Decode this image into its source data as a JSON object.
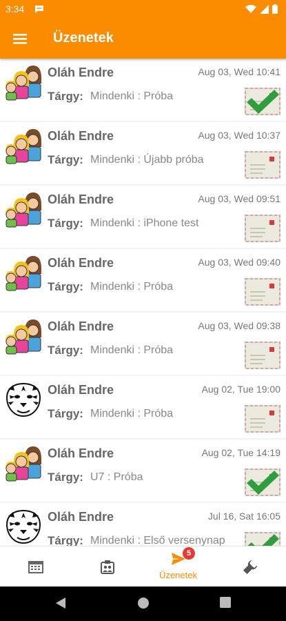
{
  "status_bar": {
    "time": "3:34"
  },
  "app_bar": {
    "title": "Üzenetek",
    "menu_icon": "hamburger-menu-icon"
  },
  "messages": [
    {
      "avatar": "family",
      "sender": "Oláh Endre",
      "date": "Aug 03, Wed 10:41",
      "subject_label": "Tárgy:",
      "subject": "Mindenki : Próba",
      "status": "read-check"
    },
    {
      "avatar": "family",
      "sender": "Oláh Endre",
      "date": "Aug 03, Wed 10:37",
      "subject_label": "Tárgy:",
      "subject": "Mindenki : Újabb próba",
      "status": "envelope"
    },
    {
      "avatar": "family",
      "sender": "Oláh Endre",
      "date": "Aug 03, Wed 09:51",
      "subject_label": "Tárgy:",
      "subject": "Mindenki : iPhone test",
      "status": "envelope"
    },
    {
      "avatar": "family",
      "sender": "Oláh Endre",
      "date": "Aug 03, Wed 09:40",
      "subject_label": "Tárgy:",
      "subject": "Mindenki : Próba",
      "status": "envelope"
    },
    {
      "avatar": "family",
      "sender": "Oláh Endre",
      "date": "Aug 03, Wed 09:38",
      "subject_label": "Tárgy:",
      "subject": "Mindenki : Próba",
      "status": "envelope"
    },
    {
      "avatar": "tiger",
      "sender": "Oláh Endre",
      "date": "Aug 02, Tue 19:00",
      "subject_label": "Tárgy:",
      "subject": "Mindenki : Próba",
      "status": "envelope"
    },
    {
      "avatar": "family",
      "sender": "Oláh Endre",
      "date": "Aug 02, Tue 14:19",
      "subject_label": "Tárgy:",
      "subject": "U7 : Próba",
      "status": "read-check"
    },
    {
      "avatar": "tiger",
      "sender": "Oláh Endre",
      "date": "Jul 16, Sat 16:05",
      "subject_label": "Tárgy:",
      "subject": "Mindenki : Első versenynap",
      "status": "read-check"
    }
  ],
  "bottom_nav": {
    "tabs": [
      {
        "name": "calendar",
        "icon": "calendar-icon"
      },
      {
        "name": "team",
        "icon": "team-roster-icon"
      },
      {
        "name": "messages",
        "icon": "paper-plane-icon",
        "label": "Üzenetek",
        "badge": "5",
        "active": true
      },
      {
        "name": "settings",
        "icon": "wrench-icon"
      }
    ]
  },
  "colors": {
    "primary": "#fb8c00",
    "badge": "#e53935",
    "check": "#2e9e3e"
  }
}
